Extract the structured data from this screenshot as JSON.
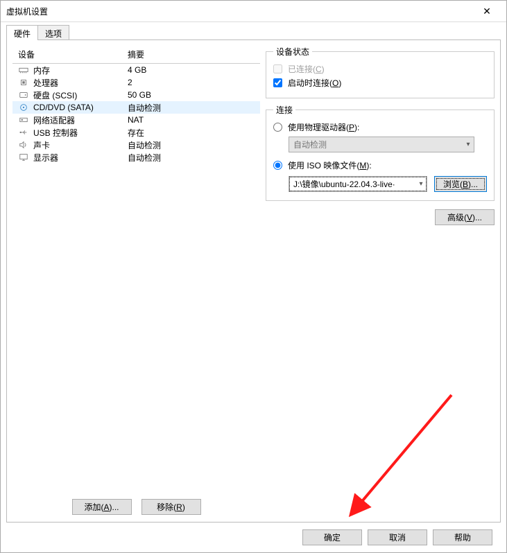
{
  "window": {
    "title": "虚拟机设置"
  },
  "tabs": {
    "hardware": "硬件",
    "options": "选项"
  },
  "list": {
    "header_device": "设备",
    "header_summary": "摘要",
    "rows": [
      {
        "icon": "memory",
        "name": "内存",
        "summary": "4 GB"
      },
      {
        "icon": "cpu",
        "name": "处理器",
        "summary": "2"
      },
      {
        "icon": "hdd",
        "name": "硬盘 (SCSI)",
        "summary": "50 GB"
      },
      {
        "icon": "cd",
        "name": "CD/DVD (SATA)",
        "summary": "自动检测"
      },
      {
        "icon": "nic",
        "name": "网络适配器",
        "summary": "NAT"
      },
      {
        "icon": "usb",
        "name": "USB 控制器",
        "summary": "存在"
      },
      {
        "icon": "sound",
        "name": "声卡",
        "summary": "自动检测"
      },
      {
        "icon": "display",
        "name": "显示器",
        "summary": "自动检测"
      }
    ]
  },
  "left_buttons": {
    "add": "添加(",
    "add_u": "A",
    "add_tail": ")...",
    "remove": "移除(",
    "remove_u": "R",
    "remove_tail": ")"
  },
  "status_box": {
    "legend": "设备状态",
    "connected": "已连接(",
    "connected_u": "C",
    "connected_tail": ")",
    "connect_at_power_on": "启动时连接(",
    "cap_u": "O",
    "cap_tail": ")"
  },
  "connection_box": {
    "legend": "连接",
    "use_physical": "使用物理驱动器(",
    "use_physical_u": "P",
    "use_physical_tail": "):",
    "auto_detect": "自动检测",
    "use_iso": "使用 ISO 映像文件(",
    "use_iso_u": "M",
    "use_iso_tail": "):",
    "iso_path": "J:\\镜像\\ubuntu-22.04.3-live·",
    "browse": "浏览(",
    "browse_u": "B",
    "browse_tail": ")..."
  },
  "advanced": {
    "label": "高级(",
    "u": "V",
    "tail": ")..."
  },
  "dialog_buttons": {
    "ok": "确定",
    "cancel": "取消",
    "help": "帮助"
  }
}
